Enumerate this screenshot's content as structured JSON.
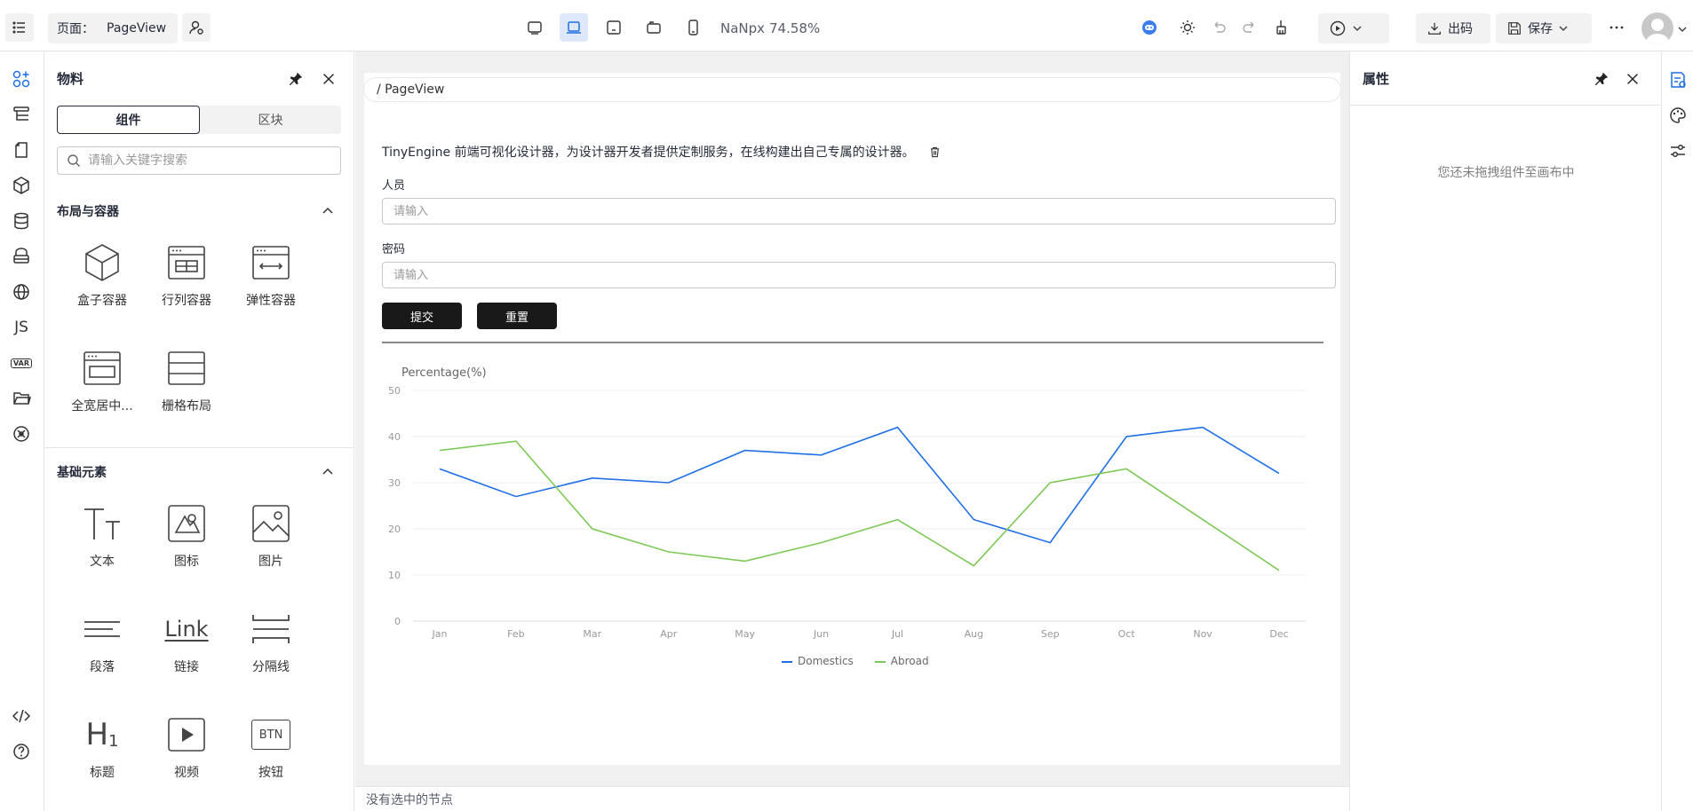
{
  "toolbar": {
    "page_label": "页面：",
    "page_name": "PageView",
    "viewport_width": "NaNpx",
    "zoom": "74.58%",
    "export_label": "出码",
    "save_label": "保存"
  },
  "left_panel": {
    "title": "物料",
    "tabs": {
      "active": "组件",
      "inactive": "区块"
    },
    "search_placeholder": "请输入关键字搜索",
    "sections": [
      {
        "title": "布局与容器",
        "items": [
          {
            "label": "盒子容器",
            "icon": "cube-icon"
          },
          {
            "label": "行列容器",
            "icon": "row-col-icon"
          },
          {
            "label": "弹性容器",
            "icon": "flex-icon"
          },
          {
            "label": "全宽居中...",
            "icon": "full-width-icon"
          },
          {
            "label": "栅格布局",
            "icon": "grid-icon"
          }
        ]
      },
      {
        "title": "基础元素",
        "items": [
          {
            "label": "文本",
            "icon": "text-icon"
          },
          {
            "label": "图标",
            "icon": "icon-icon"
          },
          {
            "label": "图片",
            "icon": "image-icon"
          },
          {
            "label": "段落",
            "icon": "paragraph-icon"
          },
          {
            "label": "链接",
            "icon": "link-icon"
          },
          {
            "label": "分隔线",
            "icon": "divider-icon"
          },
          {
            "label": "标题",
            "icon": "heading-icon"
          },
          {
            "label": "视频",
            "icon": "video-icon"
          },
          {
            "label": "按钮",
            "icon": "button-icon"
          }
        ]
      }
    ],
    "link_icon_text": "Link",
    "btn_icon_text": "BTN",
    "heading_icon_text": "H"
  },
  "canvas": {
    "breadcrumb": "/ PageView",
    "intro_text": "TinyEngine 前端可视化设计器，为设计器开发者提供定制服务，在线构建出自己专属的设计器。",
    "fields": [
      {
        "label": "人员",
        "placeholder": "请输入"
      },
      {
        "label": "密码",
        "placeholder": "请输入"
      }
    ],
    "submit_label": "提交",
    "reset_label": "重置",
    "status": "没有选中的节点"
  },
  "right_panel": {
    "title": "属性",
    "empty_text": "您还未拖拽组件至画布中"
  },
  "rail": {
    "js_label": "JS",
    "var_label": "VAR"
  },
  "chart_data": {
    "type": "line",
    "title": "",
    "ylabel": "Percentage(%)",
    "categories": [
      "Jan",
      "Feb",
      "Mar",
      "Apr",
      "May",
      "Jun",
      "Jul",
      "Aug",
      "Sep",
      "Oct",
      "Nov",
      "Dec"
    ],
    "ylim": [
      0,
      50
    ],
    "yticks": [
      0,
      10,
      20,
      30,
      40,
      50
    ],
    "series": [
      {
        "name": "Domestics",
        "color": "#1f6fe6",
        "values": [
          33,
          27,
          31,
          30,
          37,
          36,
          42,
          22,
          17,
          40,
          42,
          32
        ]
      },
      {
        "name": "Abroad",
        "color": "#7dc856",
        "values": [
          37,
          39,
          20,
          15,
          13,
          17,
          22,
          12,
          30,
          33,
          22,
          11
        ]
      }
    ],
    "legend_position": "bottom",
    "grid": true
  }
}
